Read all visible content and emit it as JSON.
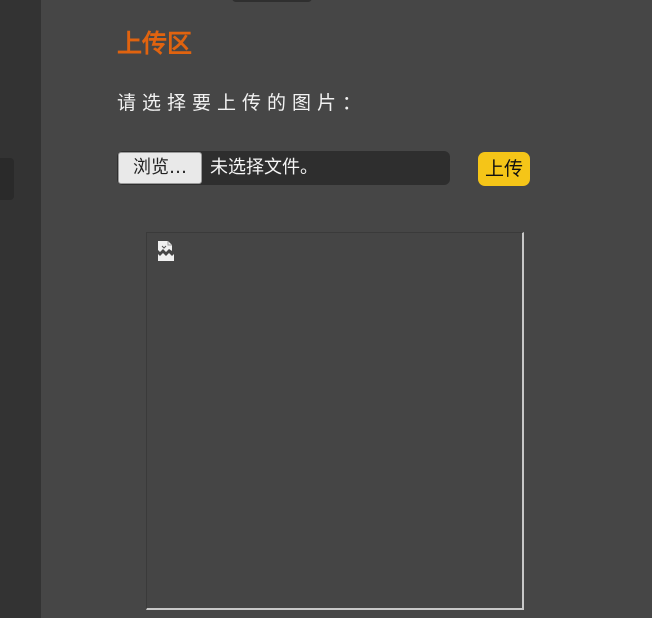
{
  "upload": {
    "title": "上传区",
    "prompt": "请选择要上传的图片：",
    "browse_label": "浏览…",
    "file_status": "未选择文件。",
    "upload_label": "上传"
  },
  "preview": {
    "icon": "broken-image-icon"
  },
  "colors": {
    "background": "#464646",
    "sidebar": "#333333",
    "title": "#e0630f",
    "upload_button": "#f5c518"
  }
}
